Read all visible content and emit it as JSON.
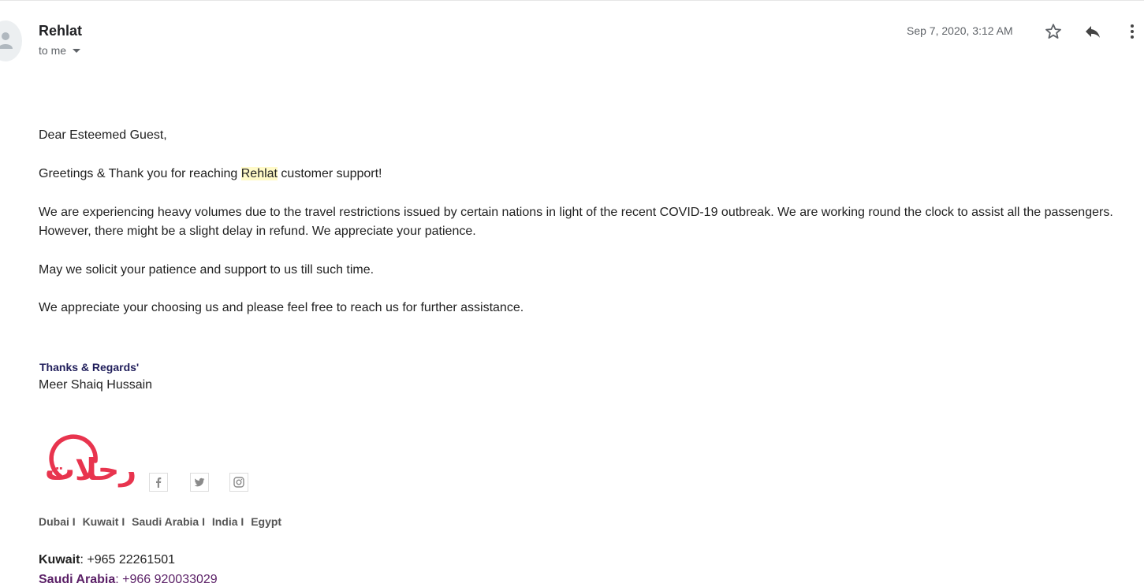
{
  "header": {
    "sender": "Rehlat",
    "recipient_label": "to me",
    "date": "Sep 7, 2020, 3:12 AM",
    "icons": [
      "star-icon",
      "reply-icon",
      "more-vert-icon"
    ]
  },
  "message": {
    "greeting": "Dear Esteemed Guest,",
    "line1_before": "Greetings & Thank you for reaching ",
    "line1_highlight": "Rehlat",
    "line1_after": " customer support!",
    "para2_line1": "We are experiencing heavy volumes due to the travel restrictions issued by certain nations in light of the recent COVID-19 outbreak. We are working round the clock to assist all the passengers.",
    "para2_line2": "However, there might be a slight delay in refund. We appreciate your patience.",
    "para3": "May we solicit your patience and support to us till such time.",
    "para4": "We appreciate your choosing us and please feel free to reach us for further assistance."
  },
  "signature": {
    "regards": "Thanks & Regards'",
    "name": "Meer Shaiq Hussain",
    "logo_text": "رحلات",
    "logo_color": "#e8344e",
    "social": [
      "facebook-icon",
      "twitter-icon",
      "instagram-icon"
    ],
    "countries": [
      "Dubai I",
      "Kuwait I",
      "Saudi Arabia I",
      "India I",
      "Egypt"
    ],
    "contacts": [
      {
        "country": "Kuwait",
        "phone": ": +965 22261501"
      },
      {
        "country": "Saudi Arabia",
        "phone": ": +966 920033029"
      }
    ]
  }
}
